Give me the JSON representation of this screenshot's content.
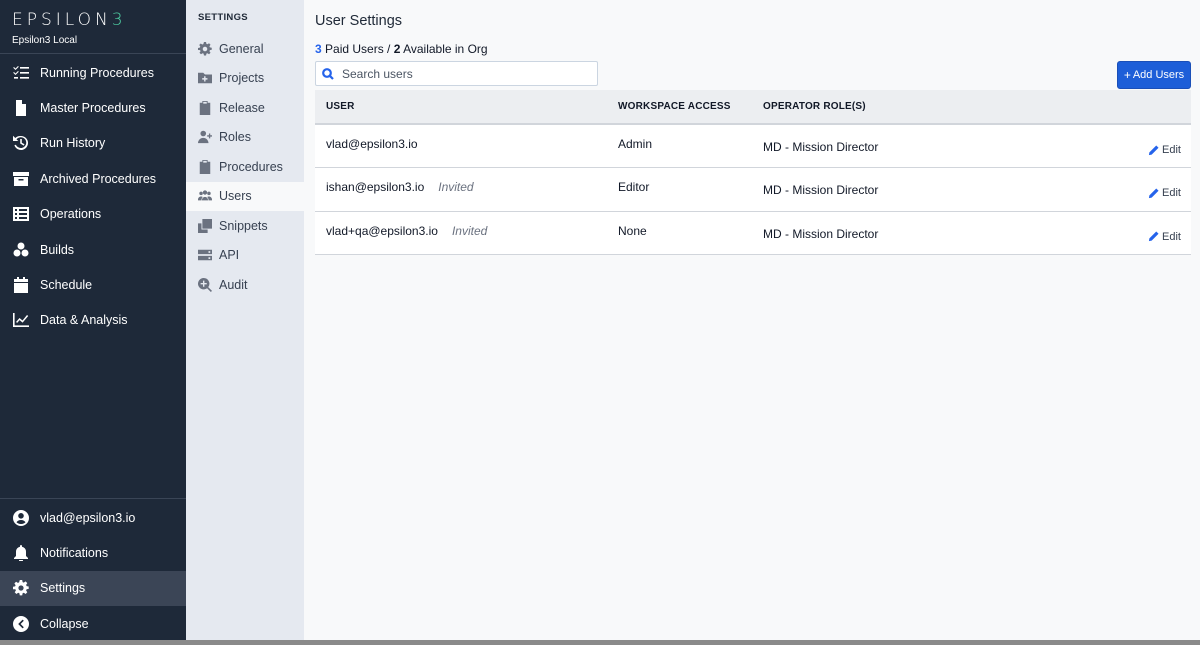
{
  "brand": {
    "logo": "EPSILON",
    "logo_suffix": "3",
    "subtitle": "Epsilon3 Local"
  },
  "nav": {
    "items": [
      {
        "label": "Running Procedures",
        "icon": "list-check-icon"
      },
      {
        "label": "Master Procedures",
        "icon": "file-icon"
      },
      {
        "label": "Run History",
        "icon": "history-icon"
      },
      {
        "label": "Archived Procedures",
        "icon": "archive-icon"
      },
      {
        "label": "Operations",
        "icon": "operations-icon"
      },
      {
        "label": "Builds",
        "icon": "cubes-icon"
      },
      {
        "label": "Schedule",
        "icon": "calendar-icon"
      },
      {
        "label": "Data & Analysis",
        "icon": "chart-line-icon"
      }
    ],
    "bottom": [
      {
        "label": "vlad@epsilon3.io",
        "icon": "user-circle-icon"
      },
      {
        "label": "Notifications",
        "icon": "bell-icon"
      },
      {
        "label": "Settings",
        "icon": "gear-icon"
      },
      {
        "label": "Collapse",
        "icon": "chevron-left-circle-icon"
      }
    ]
  },
  "settings": {
    "title": "SETTINGS",
    "items": [
      {
        "label": "General",
        "icon": "gear-icon"
      },
      {
        "label": "Projects",
        "icon": "folder-plus-icon"
      },
      {
        "label": "Release",
        "icon": "clipboard-icon"
      },
      {
        "label": "Roles",
        "icon": "user-plus-icon"
      },
      {
        "label": "Procedures",
        "icon": "clipboard-icon"
      },
      {
        "label": "Users",
        "icon": "users-icon"
      },
      {
        "label": "Snippets",
        "icon": "copy-icon"
      },
      {
        "label": "API",
        "icon": "server-icon"
      },
      {
        "label": "Audit",
        "icon": "search-plus-icon"
      }
    ],
    "active": "Users"
  },
  "main": {
    "title": "User Settings",
    "summary": {
      "paid": "3",
      "paid_text": " Paid Users / ",
      "available": "2",
      "available_text": " Available in Org"
    },
    "search_placeholder": "Search users",
    "add_button": "Add Users",
    "table": {
      "headers": [
        "USER",
        "WORKSPACE ACCESS",
        "OPERATOR ROLE(S)"
      ],
      "rows": [
        {
          "user": "vlad@epsilon3.io",
          "status": "",
          "access": "Admin",
          "role": "MD - Mission Director",
          "edit": "Edit"
        },
        {
          "user": "ishan@epsilon3.io",
          "status": "Invited",
          "access": "Editor",
          "role": "MD - Mission Director",
          "edit": "Edit"
        },
        {
          "user": "vlad+qa@epsilon3.io",
          "status": "Invited",
          "access": "None",
          "role": "MD - Mission Director",
          "edit": "Edit"
        }
      ]
    }
  },
  "colors": {
    "nav_bg": "#1e2939",
    "accent": "#1d5ed8",
    "brand_green": "#4fd1a5"
  }
}
